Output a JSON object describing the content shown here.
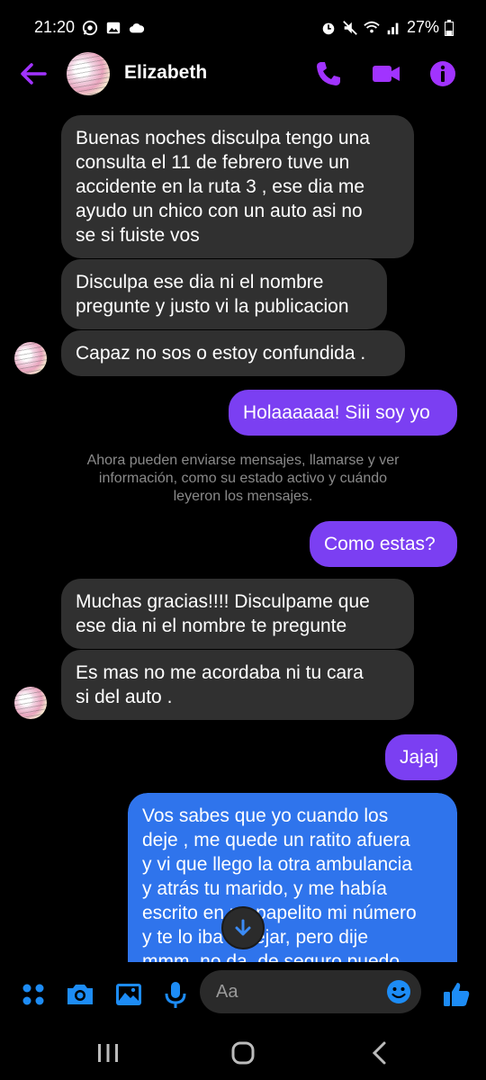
{
  "status_bar": {
    "time": "21:20",
    "battery": "27%"
  },
  "header": {
    "contact_name": "Elizabeth",
    "accent_color": "#a133ff"
  },
  "messages": [
    {
      "side": "in",
      "text": "Buenas noches disculpa tengo una\nconsulta el 11 de febrero tuve un\naccidente en la ruta 3 , ese dia me\nayudo un chico con un auto asi no\nse si fuiste vos"
    },
    {
      "side": "in",
      "text": "Disculpa ese dia ni el nombre\npregunte y justo vi la publicacion"
    },
    {
      "side": "in",
      "text": "Capaz no sos o estoy confundida ."
    },
    {
      "side": "out",
      "text": "Holaaaaaa! Siii soy yo"
    },
    {
      "side": "out",
      "text": "Como estas?"
    },
    {
      "side": "in",
      "text": "Muchas gracias!!!! Disculpame que\nese dia ni el nombre te pregunte"
    },
    {
      "side": "in",
      "text": "Es mas no me acordaba ni tu cara\nsi del auto ."
    },
    {
      "side": "out",
      "text": "Jajaj"
    },
    {
      "side": "out",
      "text": "Vos sabes que yo cuando los\ndeje , me quede un ratito afuera\ny vi que llego la otra ambulancia\ny atrás tu marido, y me había\nescrito en un papelito mi número\ny te lo iba a dejar, pero dije\nmmm, no da, de seguro puedo"
    }
  ],
  "notice": "Ahora pueden enviarse mensajes, llamarse y ver\ninformación, como su estado activo y cuándo\nleyeron los mensajes.",
  "composer": {
    "placeholder": "Aa"
  },
  "colors": {
    "outgoing_purple": "#7b3ff2",
    "outgoing_blue": "#2f74ec",
    "incoming": "#303030",
    "icon_blue": "#1d8cf5"
  }
}
